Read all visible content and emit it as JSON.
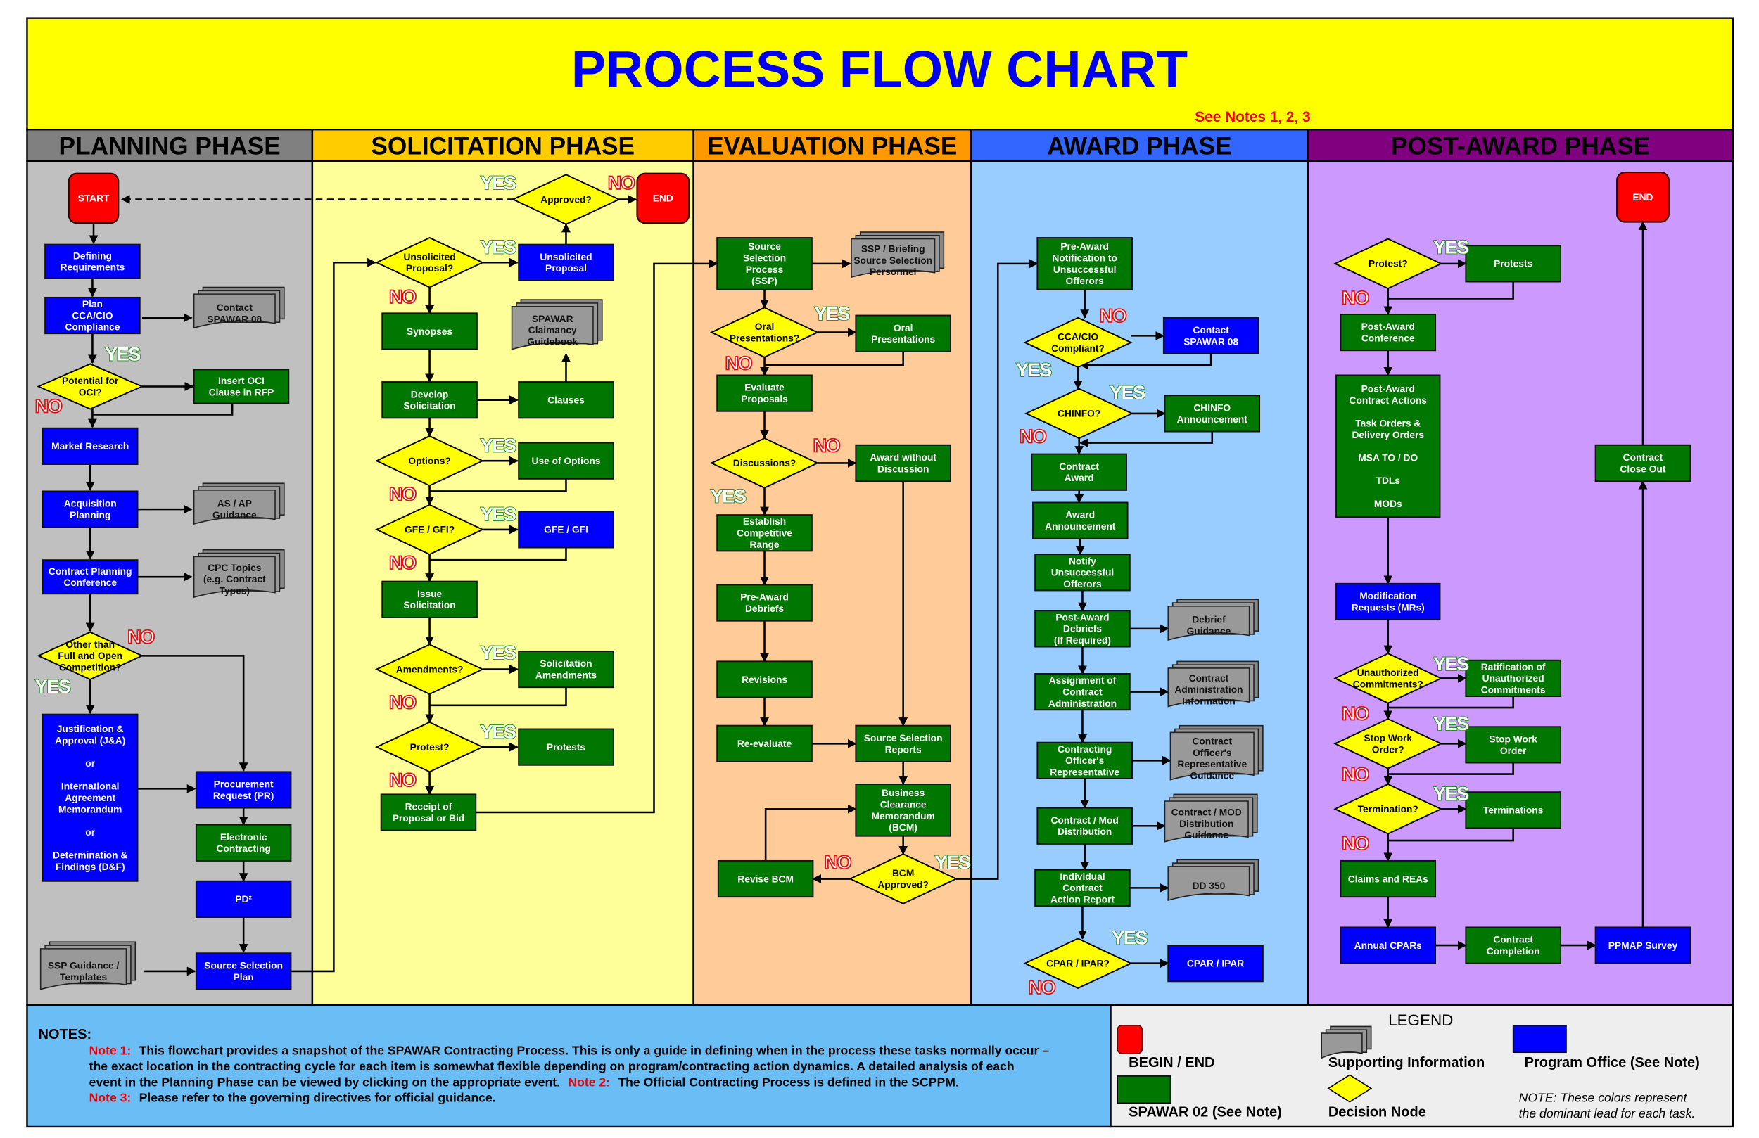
{
  "title": "PROCESS FLOW CHART",
  "see_notes": "See Notes 1, 2, 3",
  "colors": {
    "title_bg": "#ffff00",
    "title_text": "#0000ee",
    "begin_end": "#ff0000",
    "program_office": "#0000ff",
    "spawar02": "#007700",
    "decision": "#ffff00",
    "supporting": "#999999",
    "notes_bg": "#6bbdf6",
    "legend_bg": "#eeeeee"
  },
  "phases": [
    {
      "id": "planning",
      "label": "PLANNING PHASE",
      "header_color": "#808080",
      "body_color": "#c0c0c0"
    },
    {
      "id": "solicitation",
      "label": "SOLICITATION PHASE",
      "header_color": "#ffcc00",
      "body_color": "#ffff99"
    },
    {
      "id": "evaluation",
      "label": "EVALUATION PHASE",
      "header_color": "#ff9900",
      "body_color": "#ffcc99"
    },
    {
      "id": "award",
      "label": "AWARD PHASE",
      "header_color": "#3366ff",
      "body_color": "#99ccff"
    },
    {
      "id": "post_award",
      "label": "POST-AWARD PHASE",
      "header_color": "#800080",
      "body_color": "#cc99ff"
    }
  ],
  "branch_labels": {
    "yes": "YES",
    "no": "NO"
  },
  "nodes": {
    "start": {
      "type": "terminal",
      "lines": [
        "START"
      ]
    },
    "defining_req": {
      "type": "program",
      "lines": [
        "Defining",
        "Requirements"
      ]
    },
    "plan_cca": {
      "type": "program",
      "lines": [
        "Plan",
        "CCA/CIO",
        "Compliance"
      ]
    },
    "doc_contact_spawar08": {
      "type": "doc",
      "lines": [
        "Contact",
        "SPAWAR 08"
      ]
    },
    "dec_oci": {
      "type": "decision",
      "lines": [
        "Potential for",
        "OCI?"
      ]
    },
    "insert_oci": {
      "type": "spawar",
      "lines": [
        "Insert OCI",
        "Clause in RFP"
      ]
    },
    "market_research": {
      "type": "program",
      "lines": [
        "Market Research"
      ]
    },
    "acq_planning": {
      "type": "program",
      "lines": [
        "Acquisition",
        "Planning"
      ]
    },
    "doc_asap": {
      "type": "doc",
      "lines": [
        "AS / AP",
        "Guidance"
      ]
    },
    "cpc": {
      "type": "program",
      "lines": [
        "Contract Planning",
        "Conference"
      ]
    },
    "doc_cpc": {
      "type": "doc",
      "lines": [
        "CPC Topics",
        "(e.g. Contract",
        "Types)"
      ]
    },
    "dec_full_open": {
      "type": "decision",
      "lines": [
        "Other than",
        "Full and Open",
        "Competition?"
      ]
    },
    "ja": {
      "type": "program",
      "lines": [
        "Justification &",
        "Approval (J&A)",
        "",
        "or",
        "",
        "International",
        "Agreement",
        "Memorandum",
        "",
        "or",
        "",
        "Determination &",
        "Findings (D&F)"
      ]
    },
    "pr": {
      "type": "program",
      "lines": [
        "Procurement",
        "Request (PR)"
      ]
    },
    "econtracting": {
      "type": "spawar",
      "lines": [
        "Electronic",
        "Contracting"
      ]
    },
    "pd2": {
      "type": "program",
      "lines": [
        "PD²"
      ]
    },
    "doc_ssp_guidance": {
      "type": "doc",
      "lines": [
        "SSP Guidance /",
        "Templates"
      ]
    },
    "ss_plan": {
      "type": "program",
      "lines": [
        "Source Selection",
        "Plan"
      ]
    },
    "dec_approved": {
      "type": "decision",
      "lines": [
        "Approved?"
      ]
    },
    "end1": {
      "type": "terminal",
      "lines": [
        "END"
      ]
    },
    "dec_unsolicited": {
      "type": "decision",
      "lines": [
        "Unsolicited",
        "Proposal?"
      ]
    },
    "unsolicited": {
      "type": "program",
      "lines": [
        "Unsolicited",
        "Proposal"
      ]
    },
    "synopses": {
      "type": "spawar",
      "lines": [
        "Synopses"
      ]
    },
    "doc_claimancy": {
      "type": "doc",
      "lines": [
        "SPAWAR",
        "Claimancy",
        "Guidebook"
      ]
    },
    "develop_sol": {
      "type": "spawar",
      "lines": [
        "Develop",
        "Solicitation"
      ]
    },
    "clauses": {
      "type": "spawar",
      "lines": [
        "Clauses"
      ]
    },
    "dec_options": {
      "type": "decision",
      "lines": [
        "Options?"
      ]
    },
    "use_options": {
      "type": "spawar",
      "lines": [
        "Use of Options"
      ]
    },
    "dec_gfe": {
      "type": "decision",
      "lines": [
        "GFE / GFI?"
      ]
    },
    "gfe": {
      "type": "program",
      "lines": [
        "GFE / GFI"
      ]
    },
    "issue_sol": {
      "type": "spawar",
      "lines": [
        "Issue",
        "Solicitation"
      ]
    },
    "dec_amend": {
      "type": "decision",
      "lines": [
        "Amendments?"
      ]
    },
    "sol_amend": {
      "type": "spawar",
      "lines": [
        "Solicitation",
        "Amendments"
      ]
    },
    "dec_protest1": {
      "type": "decision",
      "lines": [
        "Protest?"
      ]
    },
    "protests1": {
      "type": "spawar",
      "lines": [
        "Protests"
      ]
    },
    "receipt": {
      "type": "spawar",
      "lines": [
        "Receipt of",
        "Proposal or Bid"
      ]
    },
    "ssp": {
      "type": "spawar",
      "lines": [
        "Source",
        "Selection",
        "Process",
        "(SSP)"
      ]
    },
    "doc_ssp_brief": {
      "type": "doc",
      "lines": [
        "SSP / Briefing",
        "Source Selection",
        "Personnel"
      ]
    },
    "dec_oral": {
      "type": "decision",
      "lines": [
        "Oral",
        "Presentations?"
      ]
    },
    "oral": {
      "type": "spawar",
      "lines": [
        "Oral",
        "Presentations"
      ]
    },
    "evaluate": {
      "type": "spawar",
      "lines": [
        "Evaluate",
        "Proposals"
      ]
    },
    "dec_disc": {
      "type": "decision",
      "lines": [
        "Discussions?"
      ]
    },
    "award_wo": {
      "type": "spawar",
      "lines": [
        "Award without",
        "Discussion"
      ]
    },
    "comp_range": {
      "type": "spawar",
      "lines": [
        "Establish",
        "Competitive",
        "Range"
      ]
    },
    "pre_debriefs": {
      "type": "spawar",
      "lines": [
        "Pre-Award",
        "Debriefs"
      ]
    },
    "revisions": {
      "type": "spawar",
      "lines": [
        "Revisions"
      ]
    },
    "reevaluate": {
      "type": "spawar",
      "lines": [
        "Re-evaluate"
      ]
    },
    "ss_reports": {
      "type": "spawar",
      "lines": [
        "Source Selection",
        "Reports"
      ]
    },
    "bcm": {
      "type": "spawar",
      "lines": [
        "Business",
        "Clearance",
        "Memorandum",
        "(BCM)"
      ]
    },
    "revise_bcm": {
      "type": "spawar",
      "lines": [
        "Revise BCM"
      ]
    },
    "dec_bcm": {
      "type": "decision",
      "lines": [
        "BCM",
        "Approved?"
      ]
    },
    "pre_notif": {
      "type": "spawar",
      "lines": [
        "Pre-Award",
        "Notification to",
        "Unsuccessful",
        "Offerors"
      ]
    },
    "dec_cca": {
      "type": "decision",
      "lines": [
        "CCA/CIO",
        "Compliant?"
      ]
    },
    "contact08": {
      "type": "program",
      "lines": [
        "Contact",
        "SPAWAR 08"
      ]
    },
    "dec_chinfo": {
      "type": "decision",
      "lines": [
        "CHINFO?"
      ]
    },
    "chinfo": {
      "type": "spawar",
      "lines": [
        "CHINFO",
        "Announcement"
      ]
    },
    "contract_award": {
      "type": "spawar",
      "lines": [
        "Contract",
        "Award"
      ]
    },
    "award_ann": {
      "type": "spawar",
      "lines": [
        "Award",
        "Announcement"
      ]
    },
    "notify_unsucc": {
      "type": "spawar",
      "lines": [
        "Notify",
        "Unsuccessful",
        "Offerors"
      ]
    },
    "post_debriefs": {
      "type": "spawar",
      "lines": [
        "Post-Award",
        "Debriefs",
        "(If Required)"
      ]
    },
    "doc_debrief": {
      "type": "doc",
      "lines": [
        "Debrief",
        "Guidance"
      ]
    },
    "assign_ca": {
      "type": "spawar",
      "lines": [
        "Assignment of",
        "Contract",
        "Administration"
      ]
    },
    "doc_ca_info": {
      "type": "doc",
      "lines": [
        "Contract",
        "Administration",
        "Information"
      ]
    },
    "cor": {
      "type": "spawar",
      "lines": [
        "Contracting",
        "Officer's",
        "Representative"
      ]
    },
    "doc_cor": {
      "type": "doc",
      "lines": [
        "Contract",
        "Officer's",
        "Representative",
        "Guidance"
      ]
    },
    "mod_dist": {
      "type": "spawar",
      "lines": [
        "Contract / Mod",
        "Distribution"
      ]
    },
    "doc_mod_dist": {
      "type": "doc",
      "lines": [
        "Contract / MOD",
        "Distribution",
        "Guidance"
      ]
    },
    "icar": {
      "type": "spawar",
      "lines": [
        "Individual",
        "Contract",
        "Action Report"
      ]
    },
    "doc_dd350": {
      "type": "doc",
      "lines": [
        "DD 350"
      ]
    },
    "dec_cpar": {
      "type": "decision",
      "lines": [
        "CPAR / IPAR?"
      ]
    },
    "cpar": {
      "type": "program",
      "lines": [
        "CPAR / IPAR"
      ]
    },
    "end2": {
      "type": "terminal",
      "lines": [
        "END"
      ]
    },
    "dec_protest2": {
      "type": "decision",
      "lines": [
        "Protest?"
      ]
    },
    "protests2": {
      "type": "spawar",
      "lines": [
        "Protests"
      ]
    },
    "post_conf": {
      "type": "spawar",
      "lines": [
        "Post-Award",
        "Conference"
      ]
    },
    "post_actions": {
      "type": "spawar",
      "lines": [
        "Post-Award",
        "Contract Actions",
        "",
        "Task Orders &",
        "Delivery Orders",
        "",
        "MSA TO / DO",
        "",
        "TDLs",
        "",
        "MODs"
      ]
    },
    "close_out": {
      "type": "spawar",
      "lines": [
        "Contract",
        "Close Out"
      ]
    },
    "mrs": {
      "type": "program",
      "lines": [
        "Modification",
        "Requests (MRs)"
      ]
    },
    "dec_unauth": {
      "type": "decision",
      "lines": [
        "Unauthorized",
        "Commitments?"
      ]
    },
    "ratification": {
      "type": "spawar",
      "lines": [
        "Ratification of",
        "Unauthorized",
        "Commitments"
      ]
    },
    "dec_stop": {
      "type": "decision",
      "lines": [
        "Stop Work",
        "Order?"
      ]
    },
    "stop_work": {
      "type": "spawar",
      "lines": [
        "Stop Work",
        "Order"
      ]
    },
    "dec_term": {
      "type": "decision",
      "lines": [
        "Termination?"
      ]
    },
    "terminations": {
      "type": "spawar",
      "lines": [
        "Terminations"
      ]
    },
    "claims": {
      "type": "spawar",
      "lines": [
        "Claims and REAs"
      ]
    },
    "annual_cpars": {
      "type": "program",
      "lines": [
        "Annual CPARs"
      ]
    },
    "completion": {
      "type": "spawar",
      "lines": [
        "Contract",
        "Completion"
      ]
    },
    "ppmap": {
      "type": "program",
      "lines": [
        "PPMAP Survey"
      ]
    }
  },
  "notes": {
    "heading": "NOTES:",
    "note1_label": "Note 1:",
    "note1_line1": "This flowchart provides a snapshot of the SPAWAR Contracting Process. This is only a guide in defining when in the process these tasks normally occur –",
    "note1_line2": "the exact location in the contracting cycle for each item is somewhat flexible depending on program/contracting action dynamics.  A detailed analysis of each",
    "note1_line3": "event in the Planning Phase can be viewed by clicking on the appropriate event.",
    "note2_label": "Note 2:",
    "note2_text": "The Official Contracting Process is defined in the SCPPM.",
    "note3_label": "Note 3:",
    "note3_text": "Please refer to the governing directives for official guidance."
  },
  "legend": {
    "title": "LEGEND",
    "begin_end": "BEGIN / END",
    "supporting": "Supporting Information",
    "program_office": "Program Office (See Note)",
    "spawar02": "SPAWAR 02 (See Note)",
    "decision": "Decision Node",
    "note_line1": "NOTE:  These colors represent",
    "note_line2": "the dominant lead for each task."
  }
}
